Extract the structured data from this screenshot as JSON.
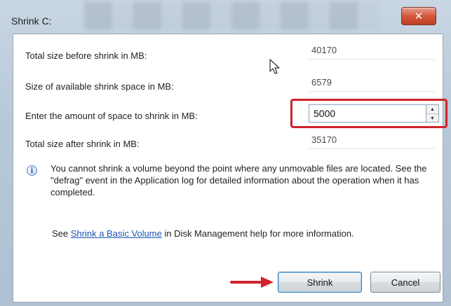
{
  "window": {
    "title": "Shrink C:",
    "close_label": "✕"
  },
  "fields": {
    "total_before_label": "Total size before shrink in MB:",
    "total_before_value": "40170",
    "available_label": "Size of available shrink space in MB:",
    "available_value": "6579",
    "enter_amount_label": "Enter the amount of space to shrink in MB:",
    "enter_amount_value": "5000",
    "total_after_label": "Total size after shrink in MB:",
    "total_after_value": "35170"
  },
  "info": {
    "icon": "info-icon",
    "text": "You cannot shrink a volume beyond the point where any unmovable files are located. See the \"defrag\" event in the Application log for detailed information about the operation when it has completed."
  },
  "help": {
    "prefix": "See ",
    "link": "Shrink a Basic Volume",
    "suffix": " in Disk Management help for more information."
  },
  "buttons": {
    "shrink": "Shrink",
    "cancel": "Cancel"
  },
  "colors": {
    "highlight": "#d2222a",
    "link": "#1f56b6",
    "close": "#c13f22"
  }
}
